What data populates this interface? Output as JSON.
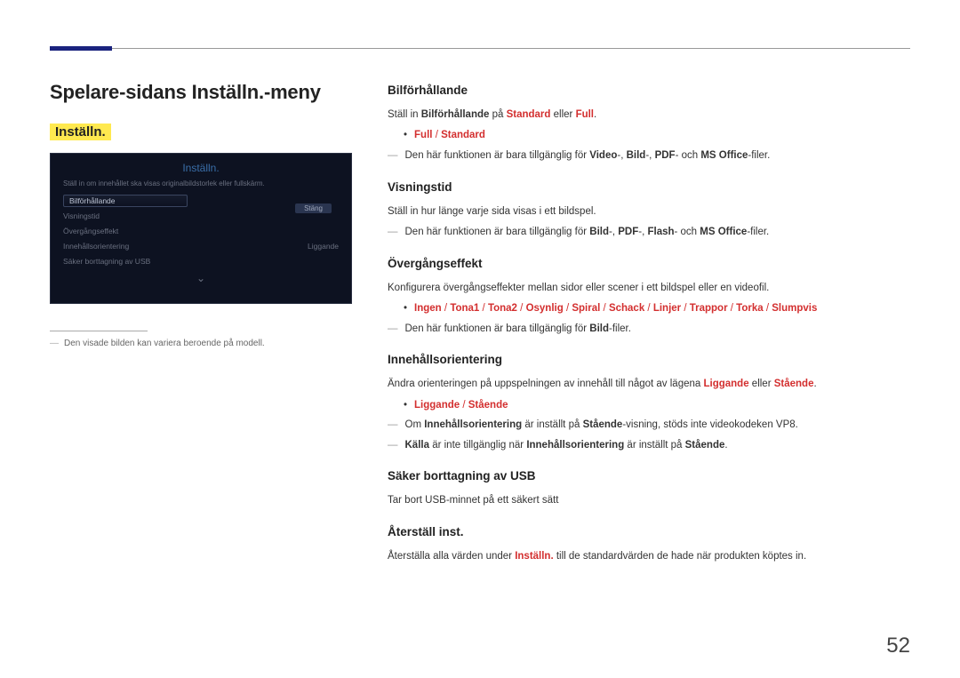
{
  "page_number": "52",
  "title": "Spelare-sidans Inställn.-meny",
  "highlight": "Inställn.",
  "screenshot": {
    "title": "Inställn.",
    "subtitle": "Ställ in om innehållet ska visas originalbildstorlek eller fullskärm.",
    "rows": [
      {
        "label": "Bilförhållande",
        "value": ""
      },
      {
        "label": "Visningstid",
        "value": ""
      },
      {
        "label": "Övergångseffekt",
        "value": ""
      },
      {
        "label": "Innehållsorientering",
        "value": "Liggande"
      },
      {
        "label": "Säker borttagning av USB",
        "value": ""
      }
    ],
    "close": "Stäng"
  },
  "left_note": "Den visade bilden kan variera beroende på modell.",
  "sections": {
    "bilf": {
      "h": "Bilförhållande",
      "p1a": "Ställ in ",
      "p1b": "Bilförhållande",
      "p1c": " på ",
      "p1d": "Standard",
      "p1e": " eller ",
      "p1f": "Full",
      "p1g": ".",
      "opt1": "Full",
      "opt2": "Standard",
      "n1a": "Den här funktionen är bara tillgänglig för ",
      "n1b": "Video",
      "n1c": "-, ",
      "n1d": "Bild",
      "n1e": "-, ",
      "n1f": "PDF",
      "n1g": "- och ",
      "n1h": "MS Office",
      "n1i": "-filer."
    },
    "vis": {
      "h": "Visningstid",
      "p1": "Ställ in hur länge varje sida visas i ett bildspel.",
      "n1a": "Den här funktionen är bara tillgänglig för ",
      "n1b": "Bild",
      "n1c": "-, ",
      "n1d": "PDF",
      "n1e": "-, ",
      "n1f": "Flash",
      "n1g": "- och ",
      "n1h": "MS Office",
      "n1i": "-filer."
    },
    "over": {
      "h": "Övergångseffekt",
      "p1": "Konfigurera övergångseffekter mellan sidor eller scener i ett bildspel eller en videofil.",
      "opts": [
        "Ingen",
        "Tona1",
        "Tona2",
        "Osynlig",
        "Spiral",
        "Schack",
        "Linjer",
        "Trappor",
        "Torka",
        "Slumpvis"
      ],
      "n1a": "Den här funktionen är bara tillgänglig för ",
      "n1b": "Bild",
      "n1c": "-filer."
    },
    "inn": {
      "h": "Innehållsorientering",
      "p1a": "Ändra orienteringen på uppspelningen av innehåll till något av lägena ",
      "p1b": "Liggande",
      "p1c": " eller ",
      "p1d": "Stående",
      "p1e": ".",
      "opt1": "Liggande",
      "opt2": "Stående",
      "n1a": "Om ",
      "n1b": "Innehållsorientering",
      "n1c": " är inställt på ",
      "n1d": "Stående",
      "n1e": "-visning, stöds inte videokodeken VP8.",
      "n2a": "Källa",
      "n2b": " är inte tillgänglig när ",
      "n2c": "Innehållsorientering",
      "n2d": " är inställt på ",
      "n2e": "Stående",
      "n2f": "."
    },
    "usb": {
      "h": "Säker borttagning av USB",
      "p1": "Tar bort USB-minnet på ett säkert sätt"
    },
    "reset": {
      "h": "Återställ inst.",
      "p1a": "Återställa alla värden under ",
      "p1b": "Inställn.",
      "p1c": " till de standardvärden de hade när produkten köptes in."
    }
  }
}
